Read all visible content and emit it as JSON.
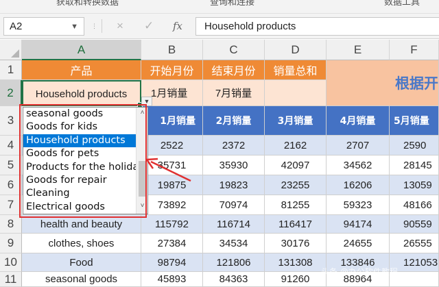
{
  "ribbon": {
    "cut_text_left": "获取和转换数据",
    "cut_text_mid": "查询和连接",
    "cut_text_right": "数据工具"
  },
  "formula_bar": {
    "name_box": "A2",
    "cancel_icon": "×",
    "enter_icon": "✓",
    "fx_label": "fx",
    "content": "Household products"
  },
  "columns": [
    "A",
    "B",
    "C",
    "D",
    "E",
    "F"
  ],
  "rows": [
    "1",
    "2",
    "3",
    "4",
    "5",
    "6",
    "7",
    "8",
    "9",
    "10",
    "11"
  ],
  "sheet": {
    "row1": {
      "a": "产品",
      "b": "开始月份",
      "c": "结束月份",
      "d": "销量总和",
      "ef": "根据开"
    },
    "row2": {
      "a": "Household products",
      "b": "1月销量",
      "c": "7月销量",
      "d": ""
    },
    "row3": {
      "b": "1月销量",
      "c": "2月销量",
      "d": "3月销量",
      "e": "4月销量",
      "f": "5月销量"
    },
    "data_rows": [
      {
        "a": "",
        "b": "2522",
        "c": "2372",
        "d": "2162",
        "e": "2707",
        "f": "2590"
      },
      {
        "a": "",
        "b": "35731",
        "c": "35930",
        "d": "42097",
        "e": "34562",
        "f": "28145"
      },
      {
        "a": "",
        "b": "19875",
        "c": "19823",
        "d": "23255",
        "e": "16206",
        "f": "13059"
      },
      {
        "a": "",
        "b": "73892",
        "c": "70974",
        "d": "81255",
        "e": "59323",
        "f": "48166"
      },
      {
        "a": "health and beauty",
        "b": "115792",
        "c": "116714",
        "d": "116417",
        "e": "94174",
        "f": "90559"
      },
      {
        "a": "clothes, shoes",
        "b": "27384",
        "c": "34534",
        "d": "30176",
        "e": "24655",
        "f": "26555"
      },
      {
        "a": "Food",
        "b": "98794",
        "c": "121806",
        "d": "131308",
        "e": "133846",
        "f": "121053"
      },
      {
        "a": "seasonal goods",
        "b": "45893",
        "c": "84363",
        "d": "91260",
        "e": "88964",
        "f": ""
      }
    ]
  },
  "dropdown": {
    "items": [
      "seasonal goods",
      "Goods for kids",
      "Household products",
      "Goods for pets",
      "Products for the holiday",
      "Goods for repair",
      "Cleaning",
      "Electrical goods"
    ],
    "selected": "Household products",
    "scroll_up": "˄",
    "scroll_down": "˅"
  },
  "dropdown_button_glyph": "▼",
  "watermark": "头条 @办公软件教程",
  "colors": {
    "orange_header": "#ef8a35",
    "peach": "#fde4d3",
    "blue_header": "#4472c4",
    "light_blue": "#dae3f3",
    "excel_green": "#217346",
    "annotation_red": "#e03030"
  }
}
